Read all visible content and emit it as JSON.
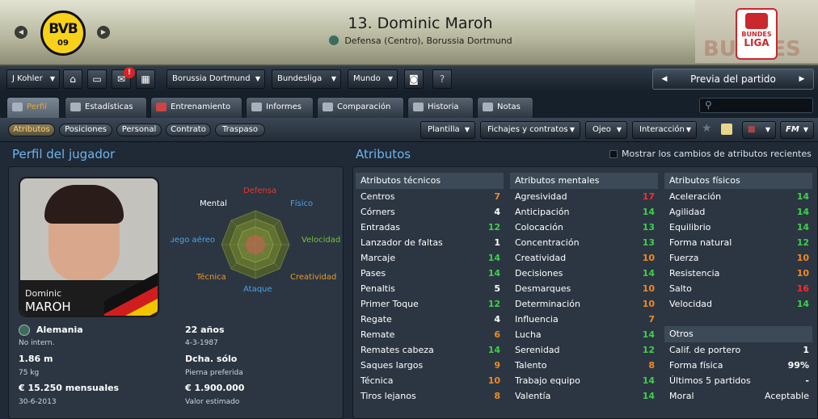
{
  "header": {
    "crest_text": "BVB",
    "crest_sub": "09",
    "player_name": "13. Dominic Maroh",
    "player_subtitle": "Defensa (Centro), Borussia Dortmund",
    "league_logo_top": "BUNDES",
    "league_logo_bottom": "LIGA",
    "league_watermark": "BUNDES"
  },
  "toolbar": {
    "manager": "J Kohler",
    "club": "Borussia Dortmund",
    "league": "Bundesliga",
    "world": "Mundo",
    "help": "?",
    "next_match": "Previa del partido",
    "notification_count": "!"
  },
  "tabs": [
    {
      "label": "Perfil"
    },
    {
      "label": "Estadísticas"
    },
    {
      "label": "Entrenamiento"
    },
    {
      "label": "Informes"
    },
    {
      "label": "Comparación"
    },
    {
      "label": "Historia"
    },
    {
      "label": "Notas"
    }
  ],
  "subtabs": [
    {
      "label": "Atributos"
    },
    {
      "label": "Posiciones"
    },
    {
      "label": "Personal"
    },
    {
      "label": "Contrato"
    },
    {
      "label": "Traspaso"
    }
  ],
  "actions": {
    "squad": "Plantilla",
    "contracts": "Fichajes y contratos",
    "scout": "Ojeo",
    "interaction": "Interacción",
    "fm": "FM"
  },
  "profile": {
    "section_title": "Perfil del jugador",
    "photo_first": "Dominic",
    "photo_last": "MAROH",
    "nation": "Alemania",
    "caps": "No intern.",
    "age": "22 años",
    "dob": "4-3-1987",
    "height": "1.86 m",
    "weight": "75 kg",
    "foot": "Dcha. sólo",
    "foot_label": "Pierna preferida",
    "wage": "€ 15.250 mensuales",
    "contract_end": "30-6-2013",
    "value": "€ 1.900.000",
    "value_label": "Valor estimado"
  },
  "radar": {
    "labels": {
      "defensa": "Defensa",
      "fisico": "Físico",
      "velocidad": "Velocidad",
      "creatividad": "Creatividad",
      "ataque": "Ataque",
      "tecnica": "Técnica",
      "juego_aereo": "Juego aéreo",
      "mental": "Mental"
    },
    "colors": {
      "defensa": "#e03a2e",
      "fisico": "#4aa3e6",
      "velocidad": "#77c23a",
      "creatividad": "#e89a2a",
      "ataque": "#4aa3e6",
      "tecnica": "#e89a2a",
      "juego_aereo": "#4aa3e6",
      "mental": "#ffffff"
    }
  },
  "attributes": {
    "section_title": "Atributos",
    "show_changes_label": "Mostrar los cambios de atributos recientes",
    "technical": {
      "title": "Atributos técnicos",
      "rows": [
        {
          "name": "Centros",
          "value": "7"
        },
        {
          "name": "Córners",
          "value": "4"
        },
        {
          "name": "Entradas",
          "value": "12"
        },
        {
          "name": "Lanzador de faltas",
          "value": "1"
        },
        {
          "name": "Marcaje",
          "value": "14"
        },
        {
          "name": "Pases",
          "value": "14"
        },
        {
          "name": "Penaltis",
          "value": "5"
        },
        {
          "name": "Primer Toque",
          "value": "12"
        },
        {
          "name": "Regate",
          "value": "4"
        },
        {
          "name": "Remate",
          "value": "6"
        },
        {
          "name": "Remates cabeza",
          "value": "14"
        },
        {
          "name": "Saques largos",
          "value": "9"
        },
        {
          "name": "Técnica",
          "value": "10"
        },
        {
          "name": "Tiros lejanos",
          "value": "8"
        }
      ]
    },
    "mental": {
      "title": "Atributos mentales",
      "rows": [
        {
          "name": "Agresividad",
          "value": "17"
        },
        {
          "name": "Anticipación",
          "value": "14"
        },
        {
          "name": "Colocación",
          "value": "13"
        },
        {
          "name": "Concentración",
          "value": "13"
        },
        {
          "name": "Creatividad",
          "value": "10"
        },
        {
          "name": "Decisiones",
          "value": "14"
        },
        {
          "name": "Desmarques",
          "value": "10"
        },
        {
          "name": "Determinación",
          "value": "10"
        },
        {
          "name": "Influencia",
          "value": "7"
        },
        {
          "name": "Lucha",
          "value": "14"
        },
        {
          "name": "Serenidad",
          "value": "12"
        },
        {
          "name": "Talento",
          "value": "8"
        },
        {
          "name": "Trabajo equipo",
          "value": "14"
        },
        {
          "name": "Valentía",
          "value": "14"
        }
      ]
    },
    "physical": {
      "title": "Atributos físicos",
      "rows": [
        {
          "name": "Aceleración",
          "value": "14"
        },
        {
          "name": "Agilidad",
          "value": "14"
        },
        {
          "name": "Equilibrio",
          "value": "14"
        },
        {
          "name": "Forma natural",
          "value": "12"
        },
        {
          "name": "Fuerza",
          "value": "10"
        },
        {
          "name": "Resistencia",
          "value": "10"
        },
        {
          "name": "Salto",
          "value": "16"
        },
        {
          "name": "Velocidad",
          "value": "14"
        }
      ]
    },
    "others": {
      "title": "Otros",
      "rows": [
        {
          "name": "Calif. de portero",
          "value": "1"
        },
        {
          "name": "Forma física",
          "value": "99%"
        },
        {
          "name": "Últimos 5 partidos",
          "value": "-"
        },
        {
          "name": "Moral",
          "value": "Aceptable"
        }
      ]
    }
  },
  "value_colors": {
    "white": "#ffffff",
    "orange": "#f08a24",
    "green": "#3fcf4a",
    "red": "#ff2a2a"
  }
}
